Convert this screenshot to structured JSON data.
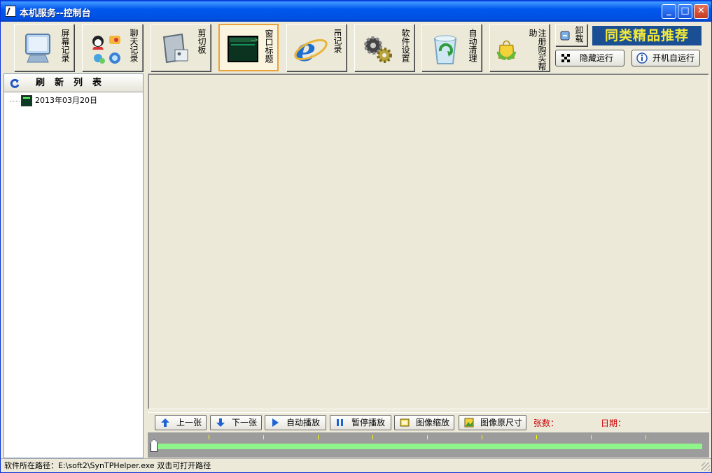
{
  "window": {
    "title": "本机服务--控制台",
    "buttons": {
      "minimize": "_",
      "maximize": "□",
      "close": "✕"
    }
  },
  "toolbar": {
    "items": [
      {
        "label": "屏幕记录",
        "icon": "monitor-icon"
      },
      {
        "label": "聊天记录",
        "icon": "chat-icons"
      },
      {
        "label": "剪切板",
        "icon": "clipboard-icon"
      },
      {
        "label": "窗口标题",
        "icon": "window-icon",
        "active": true
      },
      {
        "label": "IE记录",
        "icon": "ie-icon"
      },
      {
        "label": "软件设置",
        "icon": "gears-icon"
      },
      {
        "label": "自动清理",
        "icon": "recycle-icon"
      },
      {
        "label": "注册购买帮助",
        "icon": "shopping-bag-icon"
      }
    ],
    "uninstall_label": "卸载",
    "hide_label": "隐藏运行",
    "autostart_label": "开机自运行",
    "promo_label": "同类精品推荐"
  },
  "sidebar": {
    "refresh_label": "刷新列表",
    "tree": [
      {
        "label": "2013年03月20日"
      }
    ]
  },
  "controls": {
    "prev_label": "上一张",
    "next_label": "下一张",
    "autoplay_label": "自动播放",
    "pause_label": "暂停播放",
    "zoom_label": "图像缩放",
    "original_label": "图像原尺寸",
    "count_label": "张数：",
    "date_label": "日期："
  },
  "status": {
    "path_text": "软件所在路径：E:\\soft2\\SynTPHelper.exe 双击可打开路径"
  },
  "colors": {
    "titlebar": "#0058ee",
    "promo_bg": "#1b4f94",
    "promo_text": "#f5ea38",
    "slider_track": "#8ff58a",
    "label_red": "#cc0000"
  }
}
